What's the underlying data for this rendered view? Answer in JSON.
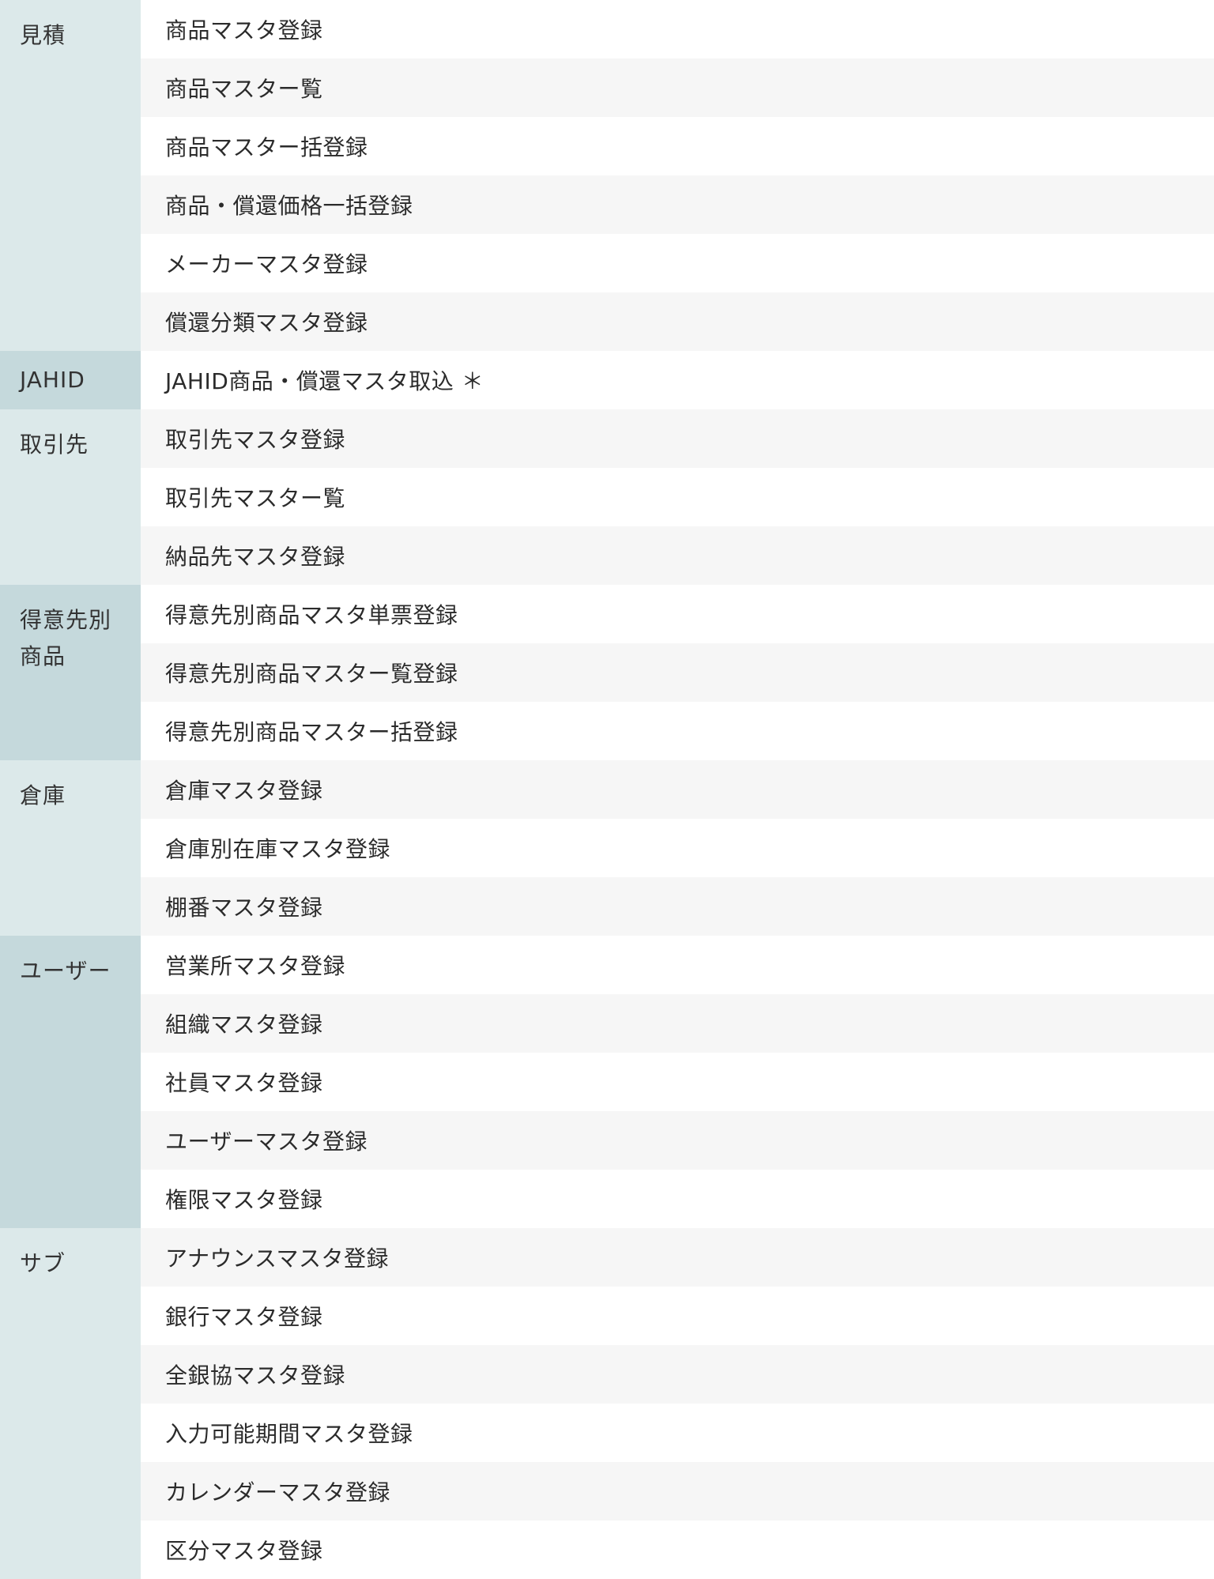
{
  "menu": [
    {
      "category": "見積",
      "items": [
        "商品マスタ登録",
        "商品マスター覧",
        "商品マスター括登録",
        "商品・償還価格一括登録",
        "メーカーマスタ登録",
        "償還分類マスタ登録"
      ]
    },
    {
      "category": "JAHID",
      "items": [
        "JAHID商品・償還マスタ取込 ＊"
      ]
    },
    {
      "category": "取引先",
      "items": [
        "取引先マスタ登録",
        "取引先マスター覧",
        "納品先マスタ登録"
      ]
    },
    {
      "category": "得意先別商品",
      "items": [
        "得意先別商品マスタ単票登録",
        "得意先別商品マスター覧登録",
        "得意先別商品マスター括登録"
      ]
    },
    {
      "category": "倉庫",
      "items": [
        "倉庫マスタ登録",
        "倉庫別在庫マスタ登録",
        "棚番マスタ登録"
      ]
    },
    {
      "category": "ユーザー",
      "items": [
        "営業所マスタ登録",
        "組織マスタ登録",
        "社員マスタ登録",
        "ユーザーマスタ登録",
        "権限マスタ登録"
      ]
    },
    {
      "category": "サブ",
      "items": [
        "アナウンスマスタ登録",
        "銀行マスタ登録",
        "全銀協マスタ登録",
        "入力可能期間マスタ登録",
        "カレンダーマスタ登録",
        "区分マスタ登録"
      ]
    }
  ]
}
